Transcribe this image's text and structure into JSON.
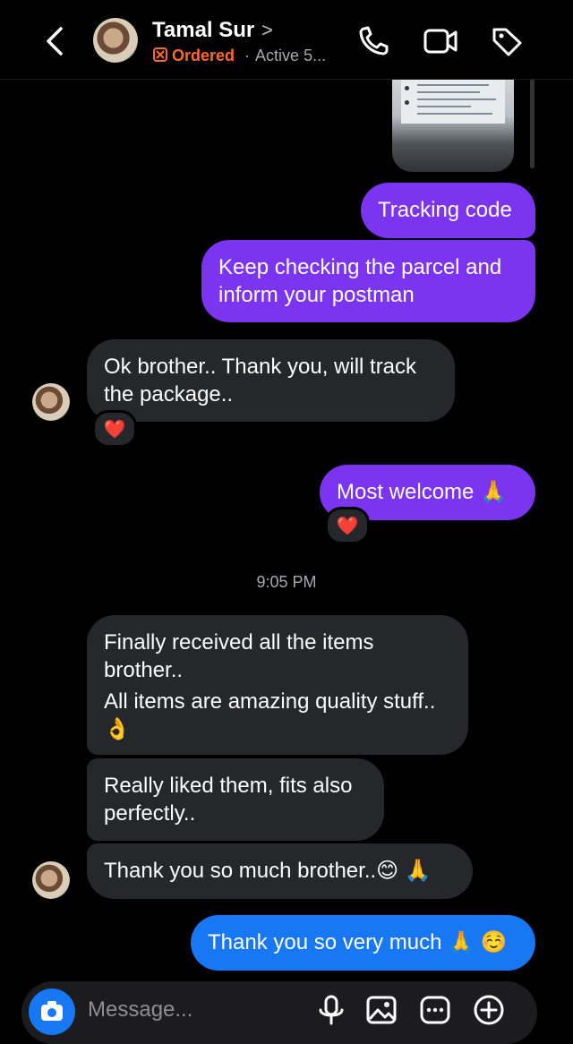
{
  "header": {
    "contact_name": "Tamal Sur",
    "name_chevron": ">",
    "status_tag": "Ordered",
    "separator": "·",
    "activity": "Active 5...",
    "icons": [
      "back-chevron-icon",
      "phone-icon",
      "video-camera-icon",
      "tag-icon"
    ]
  },
  "messages": [
    {
      "id": "m1",
      "direction": "outgoing",
      "text": "Tracking code"
    },
    {
      "id": "m2",
      "direction": "outgoing",
      "lines": [
        "Keep checking the parcel and",
        "inform your postman"
      ]
    },
    {
      "id": "m3",
      "direction": "incoming",
      "lines": [
        "Ok brother.. Thank you, will track",
        "the package.."
      ],
      "reaction": "❤️"
    },
    {
      "id": "m4",
      "direction": "outgoing",
      "text": "Most welcome 🙏",
      "reaction": "❤️"
    },
    {
      "id": "m5",
      "direction": "incoming",
      "lines": [
        "Finally received all the items",
        "brother..",
        "All items are amazing quality stuff..",
        "👌"
      ]
    },
    {
      "id": "m6",
      "direction": "incoming",
      "lines": [
        "Really liked them, fits also",
        "perfectly.."
      ]
    },
    {
      "id": "m7",
      "direction": "incoming",
      "text": "Thank you so much brother..😊 🙏"
    },
    {
      "id": "m8",
      "direction": "outgoing",
      "text": "Thank you so very much 🙏 ☺️"
    }
  ],
  "timestamp": "9:05 PM",
  "composer": {
    "placeholder": "Message...",
    "icons": [
      "camera-icon",
      "microphone-icon",
      "gallery-icon",
      "sticker-icon",
      "plus-icon"
    ]
  },
  "colors": {
    "background": "#000000",
    "incoming_bubble": "#26272b",
    "outgoing_purple": "#7b34f0",
    "outgoing_blue": "#1877f2",
    "ordered_accent": "#ff6a2b"
  }
}
